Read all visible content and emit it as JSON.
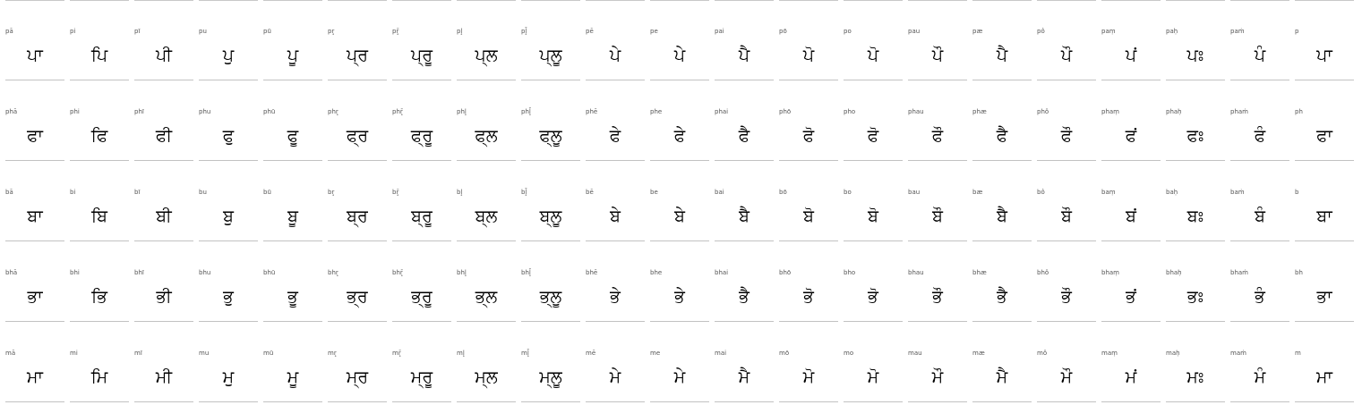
{
  "rows": [
    {
      "name": "pa",
      "cells": [
        {
          "translit": "pā",
          "glyph": "ਪਾ"
        },
        {
          "translit": "pi",
          "glyph": "ਪਿ"
        },
        {
          "translit": "pī",
          "glyph": "ਪੀ"
        },
        {
          "translit": "pu",
          "glyph": "ਪੁ"
        },
        {
          "translit": "pū",
          "glyph": "ਪੂ"
        },
        {
          "translit": "pr̥",
          "glyph": "ਪ੍ਰ"
        },
        {
          "translit": "pr̥̄",
          "glyph": "ਪ੍ਰੂ"
        },
        {
          "translit": "pl̥",
          "glyph": "ਪ੍ਲ"
        },
        {
          "translit": "pl̥̄",
          "glyph": "ਪ੍ਲੂ"
        },
        {
          "translit": "pē",
          "glyph": "ਪੇ"
        },
        {
          "translit": "pe",
          "glyph": "ਪੇ"
        },
        {
          "translit": "pai",
          "glyph": "ਪੈ"
        },
        {
          "translit": "pō",
          "glyph": "ਪੋ"
        },
        {
          "translit": "po",
          "glyph": "ਪੋ"
        },
        {
          "translit": "pau",
          "glyph": "ਪੌ"
        },
        {
          "translit": "pæ",
          "glyph": "ਪੈ"
        },
        {
          "translit": "pô",
          "glyph": "ਪੌ"
        },
        {
          "translit": "paṃ",
          "glyph": "ਪਂ"
        },
        {
          "translit": "paḥ",
          "glyph": "ਪਃ"
        },
        {
          "translit": "paṁ",
          "glyph": "ਪੰ"
        },
        {
          "translit": "p",
          "glyph": "ਪਾ"
        }
      ]
    },
    {
      "name": "pha",
      "cells": [
        {
          "translit": "phā",
          "glyph": "ਫਾ"
        },
        {
          "translit": "phi",
          "glyph": "ਫਿ"
        },
        {
          "translit": "phī",
          "glyph": "ਫੀ"
        },
        {
          "translit": "phu",
          "glyph": "ਫੁ"
        },
        {
          "translit": "phū",
          "glyph": "ਫੂ"
        },
        {
          "translit": "phr̥",
          "glyph": "ਫ੍ਰ"
        },
        {
          "translit": "phr̥̄",
          "glyph": "ਫ੍ਰੂ"
        },
        {
          "translit": "phl̥",
          "glyph": "ਫ੍ਲ"
        },
        {
          "translit": "phl̥̄",
          "glyph": "ਫ੍ਲੂ"
        },
        {
          "translit": "phē",
          "glyph": "ਫੇ"
        },
        {
          "translit": "phe",
          "glyph": "ਫੇ"
        },
        {
          "translit": "phai",
          "glyph": "ਫੈ"
        },
        {
          "translit": "phō",
          "glyph": "ਫੋ"
        },
        {
          "translit": "pho",
          "glyph": "ਫੋ"
        },
        {
          "translit": "phau",
          "glyph": "ਫੌ"
        },
        {
          "translit": "phæ",
          "glyph": "ਫੈ"
        },
        {
          "translit": "phô",
          "glyph": "ਫੌ"
        },
        {
          "translit": "phaṃ",
          "glyph": "ਫਂ"
        },
        {
          "translit": "phaḥ",
          "glyph": "ਫਃ"
        },
        {
          "translit": "phaṁ",
          "glyph": "ਫੰ"
        },
        {
          "translit": "ph",
          "glyph": "ਫਾ"
        }
      ]
    },
    {
      "name": "ba",
      "cells": [
        {
          "translit": "bā",
          "glyph": "ਬਾ"
        },
        {
          "translit": "bi",
          "glyph": "ਬਿ"
        },
        {
          "translit": "bī",
          "glyph": "ਬੀ"
        },
        {
          "translit": "bu",
          "glyph": "ਬੁ"
        },
        {
          "translit": "bū",
          "glyph": "ਬੂ"
        },
        {
          "translit": "br̥",
          "glyph": "ਬ੍ਰ"
        },
        {
          "translit": "br̥̄",
          "glyph": "ਬ੍ਰੂ"
        },
        {
          "translit": "bl̥",
          "glyph": "ਬ੍ਲ"
        },
        {
          "translit": "bl̥̄",
          "glyph": "ਬ੍ਲੂ"
        },
        {
          "translit": "bē",
          "glyph": "ਬੇ"
        },
        {
          "translit": "be",
          "glyph": "ਬੇ"
        },
        {
          "translit": "bai",
          "glyph": "ਬੈ"
        },
        {
          "translit": "bō",
          "glyph": "ਬੋ"
        },
        {
          "translit": "bo",
          "glyph": "ਬੋ"
        },
        {
          "translit": "bau",
          "glyph": "ਬੌ"
        },
        {
          "translit": "bæ",
          "glyph": "ਬੈ"
        },
        {
          "translit": "bô",
          "glyph": "ਬੌ"
        },
        {
          "translit": "baṃ",
          "glyph": "ਬਂ"
        },
        {
          "translit": "baḥ",
          "glyph": "ਬਃ"
        },
        {
          "translit": "baṁ",
          "glyph": "ਬੰ"
        },
        {
          "translit": "b",
          "glyph": "ਬਾ"
        }
      ]
    },
    {
      "name": "bha",
      "cells": [
        {
          "translit": "bhā",
          "glyph": "ਭਾ"
        },
        {
          "translit": "bhi",
          "glyph": "ਭਿ"
        },
        {
          "translit": "bhī",
          "glyph": "ਭੀ"
        },
        {
          "translit": "bhu",
          "glyph": "ਭੁ"
        },
        {
          "translit": "bhū",
          "glyph": "ਭੂ"
        },
        {
          "translit": "bhr̥",
          "glyph": "ਭ੍ਰ"
        },
        {
          "translit": "bhr̥̄",
          "glyph": "ਭ੍ਰੂ"
        },
        {
          "translit": "bhl̥",
          "glyph": "ਭ੍ਲ"
        },
        {
          "translit": "bhl̥̄",
          "glyph": "ਭ੍ਲੂ"
        },
        {
          "translit": "bhē",
          "glyph": "ਭੇ"
        },
        {
          "translit": "bhe",
          "glyph": "ਭੇ"
        },
        {
          "translit": "bhai",
          "glyph": "ਭੈ"
        },
        {
          "translit": "bhō",
          "glyph": "ਭੋ"
        },
        {
          "translit": "bho",
          "glyph": "ਭੋ"
        },
        {
          "translit": "bhau",
          "glyph": "ਭੌ"
        },
        {
          "translit": "bhæ",
          "glyph": "ਭੈ"
        },
        {
          "translit": "bhô",
          "glyph": "ਭੌ"
        },
        {
          "translit": "bhaṃ",
          "glyph": "ਭਂ"
        },
        {
          "translit": "bhaḥ",
          "glyph": "ਭਃ"
        },
        {
          "translit": "bhaṁ",
          "glyph": "ਭੰ"
        },
        {
          "translit": "bh",
          "glyph": "ਭਾ"
        }
      ]
    },
    {
      "name": "ma",
      "cells": [
        {
          "translit": "mā",
          "glyph": "ਮਾ"
        },
        {
          "translit": "mi",
          "glyph": "ਮਿ"
        },
        {
          "translit": "mī",
          "glyph": "ਮੀ"
        },
        {
          "translit": "mu",
          "glyph": "ਮੁ"
        },
        {
          "translit": "mū",
          "glyph": "ਮੂ"
        },
        {
          "translit": "mr̥",
          "glyph": "ਮ੍ਰ"
        },
        {
          "translit": "mr̥̄",
          "glyph": "ਮ੍ਰੂ"
        },
        {
          "translit": "ml̥",
          "glyph": "ਮ੍ਲ"
        },
        {
          "translit": "ml̥̄",
          "glyph": "ਮ੍ਲੂ"
        },
        {
          "translit": "mē",
          "glyph": "ਮੇ"
        },
        {
          "translit": "me",
          "glyph": "ਮੇ"
        },
        {
          "translit": "mai",
          "glyph": "ਮੈ"
        },
        {
          "translit": "mō",
          "glyph": "ਮੋ"
        },
        {
          "translit": "mo",
          "glyph": "ਮੋ"
        },
        {
          "translit": "mau",
          "glyph": "ਮੌ"
        },
        {
          "translit": "mæ",
          "glyph": "ਮੈ"
        },
        {
          "translit": "mô",
          "glyph": "ਮੌ"
        },
        {
          "translit": "maṃ",
          "glyph": "ਮਂ"
        },
        {
          "translit": "maḥ",
          "glyph": "ਮਃ"
        },
        {
          "translit": "maṁ",
          "glyph": "ਮੰ"
        },
        {
          "translit": "m",
          "glyph": "ਮਾ"
        }
      ]
    }
  ]
}
